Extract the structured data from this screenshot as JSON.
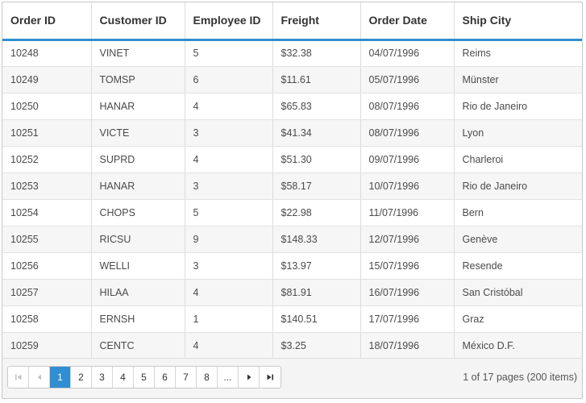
{
  "columns": [
    "Order ID",
    "Customer ID",
    "Employee ID",
    "Freight",
    "Order Date",
    "Ship City"
  ],
  "rows": [
    [
      "10248",
      "VINET",
      "5",
      "$32.38",
      "04/07/1996",
      "Reims"
    ],
    [
      "10249",
      "TOMSP",
      "6",
      "$11.61",
      "05/07/1996",
      "Münster"
    ],
    [
      "10250",
      "HANAR",
      "4",
      "$65.83",
      "08/07/1996",
      "Rio de Janeiro"
    ],
    [
      "10251",
      "VICTE",
      "3",
      "$41.34",
      "08/07/1996",
      "Lyon"
    ],
    [
      "10252",
      "SUPRD",
      "4",
      "$51.30",
      "09/07/1996",
      "Charleroi"
    ],
    [
      "10253",
      "HANAR",
      "3",
      "$58.17",
      "10/07/1996",
      "Rio de Janeiro"
    ],
    [
      "10254",
      "CHOPS",
      "5",
      "$22.98",
      "11/07/1996",
      "Bern"
    ],
    [
      "10255",
      "RICSU",
      "9",
      "$148.33",
      "12/07/1996",
      "Genève"
    ],
    [
      "10256",
      "WELLI",
      "3",
      "$13.97",
      "15/07/1996",
      "Resende"
    ],
    [
      "10257",
      "HILAA",
      "4",
      "$81.91",
      "16/07/1996",
      "San Cristóbal"
    ],
    [
      "10258",
      "ERNSH",
      "1",
      "$140.51",
      "17/07/1996",
      "Graz"
    ],
    [
      "10259",
      "CENTC",
      "4",
      "$3.25",
      "18/07/1996",
      "México D.F."
    ]
  ],
  "pager": {
    "pages": [
      "1",
      "2",
      "3",
      "4",
      "5",
      "6",
      "7",
      "8"
    ],
    "ellipsis": "...",
    "current_page": "1",
    "info": "1 of 17 pages (200 items)",
    "icons": {
      "first": "first-page-icon",
      "prev": "previous-page-icon",
      "next": "next-page-icon",
      "last": "last-page-icon"
    }
  },
  "colors": {
    "accent": "#2f8fd0",
    "header_border": "#2f8fd0",
    "alt_row": "#f6f6f6"
  }
}
